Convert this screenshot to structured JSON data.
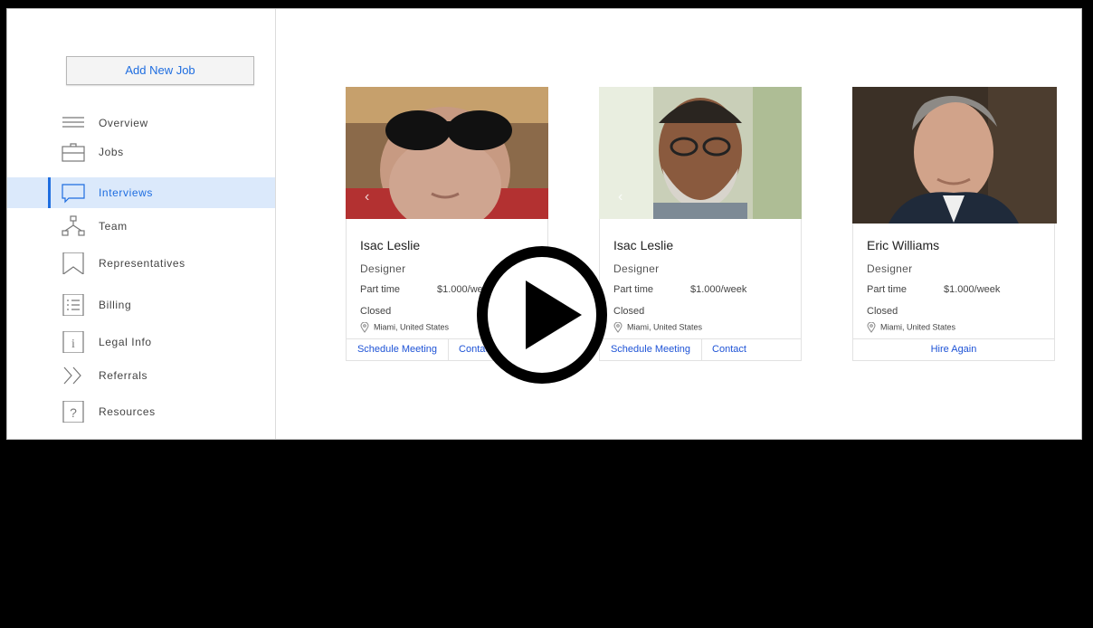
{
  "sidebar": {
    "add_job_label": "Add New Job",
    "items": [
      {
        "label": "Overview",
        "icon": "menu-lines-icon"
      },
      {
        "label": "Jobs",
        "icon": "briefcase-icon"
      },
      {
        "label": "Interviews",
        "icon": "chat-bubble-icon",
        "active": true
      },
      {
        "label": "Team",
        "icon": "team-hierarchy-icon"
      },
      {
        "label": "Representatives",
        "icon": "bookmark-icon"
      },
      {
        "label": "Billing",
        "icon": "billing-list-icon"
      },
      {
        "label": "Legal Info",
        "icon": "info-icon"
      },
      {
        "label": "Referrals",
        "icon": "double-chevron-icon"
      },
      {
        "label": "Resources",
        "icon": "question-icon"
      }
    ]
  },
  "cards": [
    {
      "name": "Isac Leslie",
      "role": "Designer",
      "type": "Part time",
      "rate": "$1.000/week",
      "status": "Closed",
      "location": "Miami, United States",
      "action1": "Schedule Meeting",
      "action2": "Contact"
    },
    {
      "name": "Isac Leslie",
      "role": "Designer",
      "type": "Part time",
      "rate": "$1.000/week",
      "status": "Closed",
      "location": "Miami, United States",
      "action1": "Schedule Meeting",
      "action2": "Contact"
    },
    {
      "name": "Eric Williams",
      "role": "Designer",
      "type": "Part time",
      "rate": "$1.000/week",
      "status": "Closed",
      "location": "Miami, United States",
      "action1": "Hire Again"
    }
  ],
  "overlay": {
    "icon": "play-button-icon"
  },
  "colors": {
    "accent": "#1e6de0",
    "active_bg": "#dbe9fb",
    "link": "#1e53d6",
    "background": "#000000"
  }
}
